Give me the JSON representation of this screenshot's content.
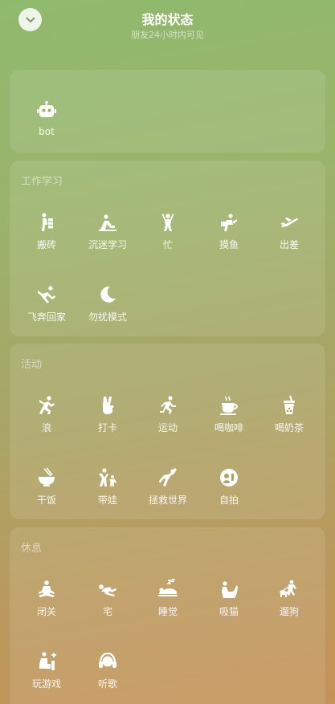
{
  "header": {
    "title": "我的状态",
    "subtitle": "朋友24小时内可见"
  },
  "sections": [
    {
      "title": "",
      "items": [
        {
          "label": "bot",
          "icon": "robot-icon"
        }
      ]
    },
    {
      "title": "工作学习",
      "items": [
        {
          "label": "搬砖",
          "icon": "brick-carrying-icon"
        },
        {
          "label": "沉迷学习",
          "icon": "studying-icon"
        },
        {
          "label": "忙",
          "icon": "busy-icon"
        },
        {
          "label": "摸鱼",
          "icon": "slacking-icon"
        },
        {
          "label": "出差",
          "icon": "airplane-icon"
        },
        {
          "label": "飞奔回家",
          "icon": "running-home-icon"
        },
        {
          "label": "勿扰模式",
          "icon": "moon-icon"
        }
      ]
    },
    {
      "title": "活动",
      "items": [
        {
          "label": "浪",
          "icon": "jumping-icon"
        },
        {
          "label": "打卡",
          "icon": "peace-hand-icon"
        },
        {
          "label": "运动",
          "icon": "running-icon"
        },
        {
          "label": "喝咖啡",
          "icon": "coffee-icon"
        },
        {
          "label": "喝奶茶",
          "icon": "bubble-tea-icon"
        },
        {
          "label": "干饭",
          "icon": "rice-bowl-icon"
        },
        {
          "label": "带娃",
          "icon": "parent-child-icon"
        },
        {
          "label": "拯救世界",
          "icon": "superhero-icon"
        },
        {
          "label": "自拍",
          "icon": "selfie-icon"
        }
      ]
    },
    {
      "title": "休息",
      "items": [
        {
          "label": "闭关",
          "icon": "meditation-icon"
        },
        {
          "label": "宅",
          "icon": "lying-icon"
        },
        {
          "label": "睡觉",
          "icon": "sleeping-icon"
        },
        {
          "label": "吸猫",
          "icon": "cat-icon"
        },
        {
          "label": "遛狗",
          "icon": "dog-icon"
        },
        {
          "label": "玩游戏",
          "icon": "gaming-icon"
        },
        {
          "label": "听歌",
          "icon": "headphones-icon"
        }
      ]
    }
  ]
}
